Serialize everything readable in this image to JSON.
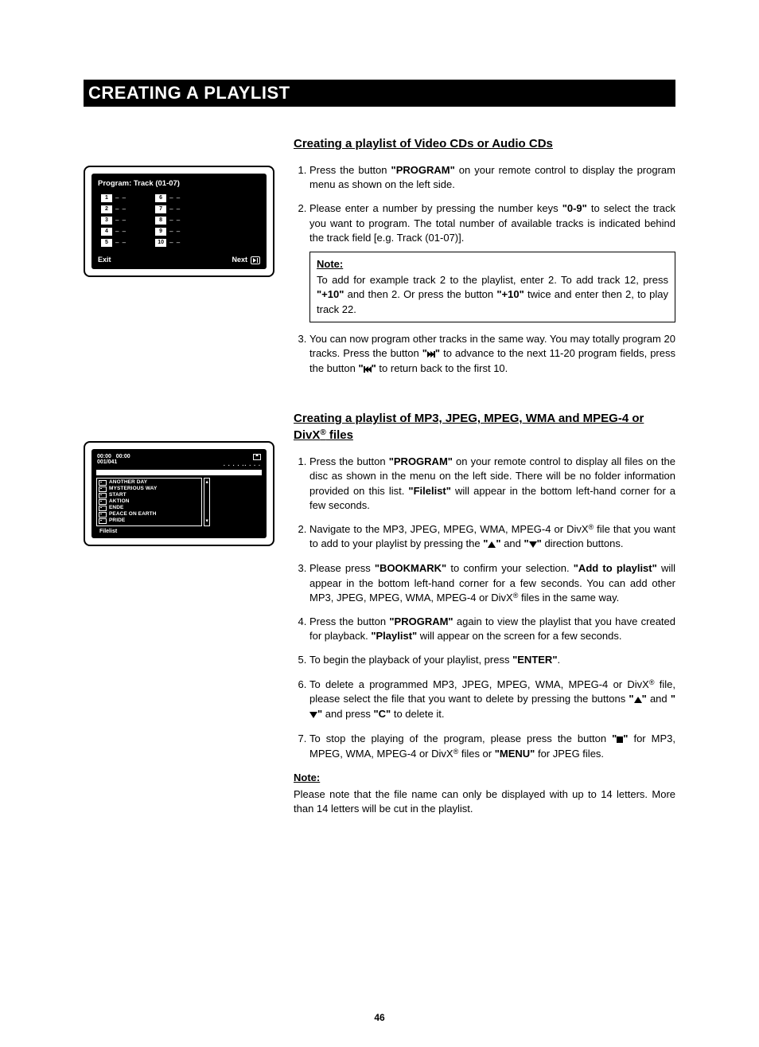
{
  "page_title": "CREATING A PLAYLIST",
  "page_number": "46",
  "program_osd": {
    "header": "Program: Track (01-07)",
    "left_nums": [
      "1",
      "2",
      "3",
      "4",
      "5"
    ],
    "right_nums": [
      "6",
      "7",
      "8",
      "9",
      "10"
    ],
    "slot_placeholder": "– –",
    "exit_label": "Exit",
    "next_label": "Next"
  },
  "file_osd": {
    "time_a": "00:00",
    "time_b": "00:00",
    "counter": "001/041",
    "dots": ". . . . .. . . .",
    "files": [
      "ANOTHER DAY",
      "MYSTERIOUS WAY",
      "START",
      "AKTION",
      "ENDE",
      "PEACE ON EARTH",
      "PRIDE"
    ],
    "footer": "Filelist"
  },
  "sections": [
    {
      "heading_html": "Creating a playlist of Video CDs or Audio CDs",
      "items": [
        {
          "html": "Press the button <b>\"PROGRAM\"</b> on your remote control to display the program menu as shown on the left side."
        },
        {
          "html": "Please enter a number by pressing the number keys <b>\"0-9\"</b> to select the track you want to program. The total number of available tracks is indicated behind the track field [e.g. Track (01-07)].",
          "note": {
            "label": "Note:",
            "body_html": "To add for example track 2 to the playlist, enter 2. To add track 12, press <b>\"+10\"</b> and then 2. Or press the button <b>\"+10\"</b> twice and enter then 2, to play track 22."
          }
        },
        {
          "html": "You can now program other tracks in the same way. You may totally program 20 tracks. Press the button <b>\"<span class='sym-ffwd' data-name='ffwd-icon' data-interactable='false'></span><span class='sym-ffwd-bar' data-name='ffwd-bar-icon' data-interactable='false'></span>\"</b> to advance to the next 11-20 program fields, press the button <b>\"<span class='sym-rev-bar' data-name='rev-bar-icon' data-interactable='false'></span><span class='sym-rev' data-name='rev-icon' data-interactable='false'></span>\"</b> to return back to the first 10."
        }
      ]
    },
    {
      "heading_html": "Creating a playlist of MP3, JPEG, MPEG, WMA and MPEG-4 or DivX<sup>®</sup> files",
      "items": [
        {
          "html": "Press the button <b>\"PROGRAM\"</b> on your remote control to display all files on the disc as shown in the menu on the left side. There will be no folder information provided on this list. <b>\"Filelist\"</b> will appear in the bottom left-hand corner for a few seconds."
        },
        {
          "html": "Navigate to the MP3, JPEG, MPEG, WMA, MPEG-4 or DivX<sup>®</sup> file that you want to add to your playlist by pressing the <b>\"<span class='sym-up' data-name='up-arrow-icon' data-interactable='false'></span>\"</b> and <b>\"<span class='sym-down' data-name='down-arrow-icon' data-interactable='false'></span>\"</b> direction buttons."
        },
        {
          "html": "Please press <b>\"BOOKMARK\"</b> to confirm your selection. <b>\"Add to playlist\"</b> will appear in the bottom left-hand corner for a few seconds. You can add other MP3, JPEG, MPEG, WMA, MPEG-4 or DivX<sup>®</sup> files in the same way."
        },
        {
          "html": "Press the button <b>\"PROGRAM\"</b> again to view the playlist that you have created for playback. <b>\"Playlist\"</b> will appear on the screen for a few seconds."
        },
        {
          "html": "To begin the playback of your playlist, press <b>\"ENTER\"</b>."
        },
        {
          "html": "To delete a programmed MP3, JPEG, MPEG, WMA, MPEG-4 or DivX<sup>®</sup> file, please select the file that you want to delete by pressing the buttons <b>\"<span class='sym-up' data-name='up-arrow-icon' data-interactable='false'></span>\"</b> and <b>\"<span class='sym-down' data-name='down-arrow-icon' data-interactable='false'></span>\"</b> and press <b>\"C\"</b> to delete it."
        },
        {
          "html": "To stop the playing of the program, please press the button <b>\"<span class='sym-stop' data-name='stop-icon' data-interactable='false'></span>\"</b> for MP3, MPEG, WMA, MPEG-4 or DivX<sup>®</sup> files or <b>\"MENU\"</b> for JPEG files."
        }
      ],
      "trailing_note": {
        "label": "Note:",
        "body_html": "Please note that the file name can only be displayed with up to 14 letters. More than 14 letters will be cut in the playlist."
      }
    }
  ]
}
